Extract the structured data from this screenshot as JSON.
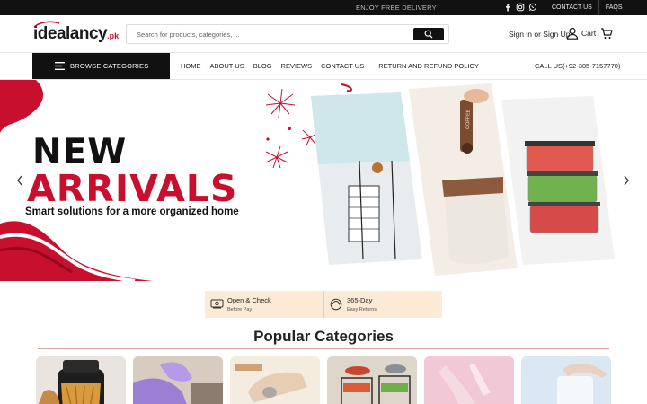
{
  "topbar": {
    "promo": "ENJOY FREE DELIVERY",
    "social_icons": [
      "facebook-icon",
      "instagram-icon",
      "whatsapp-icon"
    ],
    "links": [
      "CONTACT US",
      "FAQS"
    ]
  },
  "header": {
    "logo_main": "idealancy",
    "logo_tld": ".pk",
    "search_placeholder": "Search for products, categories, ...",
    "account_label": "Sign in or Sign Up",
    "cart_label": "Cart"
  },
  "nav": {
    "browse_label": "BROWSE CATEGORIES",
    "items": [
      "HOME",
      "ABOUT US",
      "BLOG",
      "REVIEWS",
      "CONTACT US",
      "RETURN AND REFUND POLICY"
    ],
    "phone": "CALL US(+92-305-7157770)"
  },
  "hero": {
    "line1": "NEW",
    "line2": "ARRIVALS",
    "tagline": "Smart solutions for a more organized home",
    "mug_label": "COFFEE"
  },
  "features": [
    {
      "title": "Open & Check",
      "subtitle": "Before Pay",
      "icon": "cash-icon"
    },
    {
      "title": "365-Day",
      "subtitle": "Easy Returns",
      "icon": "return-badge-icon"
    }
  ],
  "categories": {
    "title": "Popular Categories"
  },
  "colors": {
    "accent": "#c8102e",
    "topbar": "#111111",
    "feature_bg": "#fbead6"
  }
}
